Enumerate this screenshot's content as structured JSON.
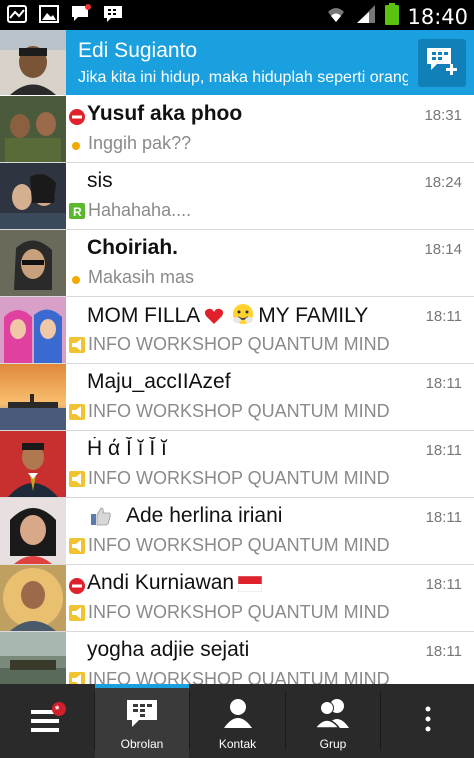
{
  "status_bar": {
    "time": "18:40",
    "left_icons": [
      "notification-icon",
      "gallery-icon",
      "bbm-notification-icon",
      "bbm-icon"
    ],
    "right_icons": [
      "wifi-icon",
      "signal-icon",
      "battery-icon"
    ]
  },
  "profile": {
    "name": "Edi Sugianto",
    "status": "Jika kita ini hidup, maka hiduplah seperti orang",
    "new_chat_icon": "new-chat-icon",
    "accent": "#1aa0de"
  },
  "chats": [
    {
      "name": "Yusuf aka phoo",
      "message": "Inggih pak??",
      "time": "18:31",
      "bold": true,
      "status_icon": "busy-icon",
      "msg_icon": "dot"
    },
    {
      "name": "sis",
      "message": "Hahahaha....",
      "time": "18:24",
      "bold": false,
      "status_icon": "",
      "msg_icon": "read-r-icon"
    },
    {
      "name": "Choiriah.",
      "message": "Makasih mas",
      "time": "18:14",
      "bold": true,
      "status_icon": "",
      "msg_icon": "dot"
    },
    {
      "name_parts": [
        "MOM FILLA",
        "MY FAMILY"
      ],
      "message": "INFO WORKSHOP QUANTUM MIND",
      "time": "18:11",
      "bold": false,
      "status_icon": "",
      "msg_icon": "broadcast-icon"
    },
    {
      "name": "Maju_accIIAzef",
      "message": "INFO WORKSHOP QUANTUM MIND",
      "time": "18:11",
      "bold": false,
      "status_icon": "",
      "msg_icon": "broadcast-icon"
    },
    {
      "name": "Ḣ ά Ĭ ĭ Ĭ ĭ",
      "message": "INFO WORKSHOP QUANTUM MIND",
      "time": "18:11",
      "bold": false,
      "status_icon": "",
      "msg_icon": "broadcast-icon"
    },
    {
      "name": "Ade herlina iriani",
      "message": "INFO WORKSHOP QUANTUM MIND",
      "time": "18:11",
      "bold": false,
      "status_icon": "thumbs-up-icon",
      "msg_icon": "broadcast-icon"
    },
    {
      "name": "Andi Kurniawan",
      "message": "INFO WORKSHOP QUANTUM MIND",
      "time": "18:11",
      "bold": false,
      "status_icon": "busy-icon",
      "msg_icon": "broadcast-icon"
    },
    {
      "name": "yogha adjie sejati",
      "message": "INFO WORKSHOP QUANTUM MIND",
      "time": "18:11",
      "bold": false,
      "status_icon": "",
      "msg_icon": "broadcast-icon"
    }
  ],
  "bottom_tabs": [
    {
      "label": "",
      "icon": "menu-icon"
    },
    {
      "label": "Obrolan",
      "icon": "chats-icon",
      "active": true
    },
    {
      "label": "Kontak",
      "icon": "contact-icon"
    },
    {
      "label": "Grup",
      "icon": "group-icon"
    },
    {
      "label": "",
      "icon": "more-icon"
    }
  ]
}
